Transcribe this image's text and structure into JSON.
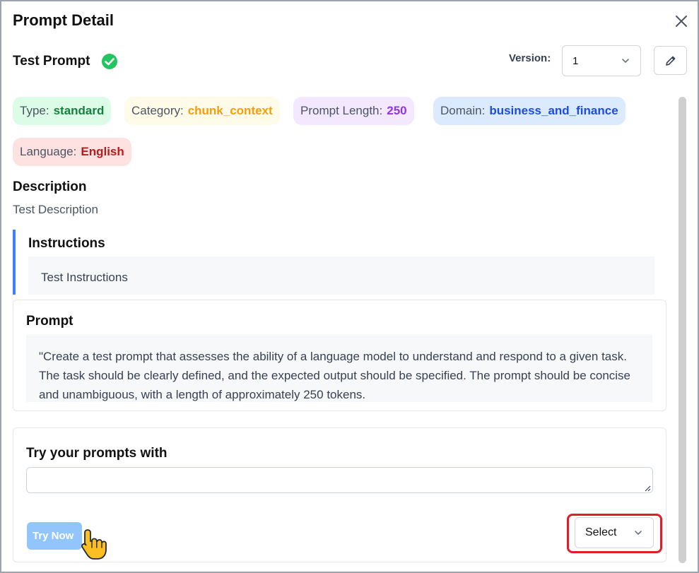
{
  "modal": {
    "title": "Prompt Detail"
  },
  "prompt": {
    "name": "Test Prompt",
    "version_label": "Version:",
    "version_value": "1"
  },
  "chips": {
    "type_label": "Type:",
    "type_value": "standard",
    "category_label": "Category:",
    "category_value": "chunk_context",
    "length_label": "Prompt Length:",
    "length_value": "250",
    "domain_label": "Domain:",
    "domain_value": "business_and_finance",
    "language_label": "Language:",
    "language_value": "English"
  },
  "description": {
    "heading": "Description",
    "text": "Test Description"
  },
  "instructions": {
    "heading": "Instructions",
    "text": "Test Instructions"
  },
  "prompt_body": {
    "heading": "Prompt",
    "text": "\"Create a test prompt that assesses the ability of a language model to understand and respond to a given task. The task should be clearly defined, and the expected output should be specified. The prompt should be concise and unambiguous, with a length of approximately 250 tokens."
  },
  "try_section": {
    "heading": "Try your prompts with",
    "input_value": "",
    "button_label": "Try Now",
    "select_value": "Select"
  },
  "icons": {
    "close": "close-icon",
    "check": "check-circle-icon",
    "chevron": "chevron-down-icon",
    "edit": "pencil-icon",
    "cursor": "hand-pointer-icon"
  },
  "colors": {
    "accent": "#3b82f6",
    "success": "#22c55e",
    "highlight": "#e11d2b"
  }
}
